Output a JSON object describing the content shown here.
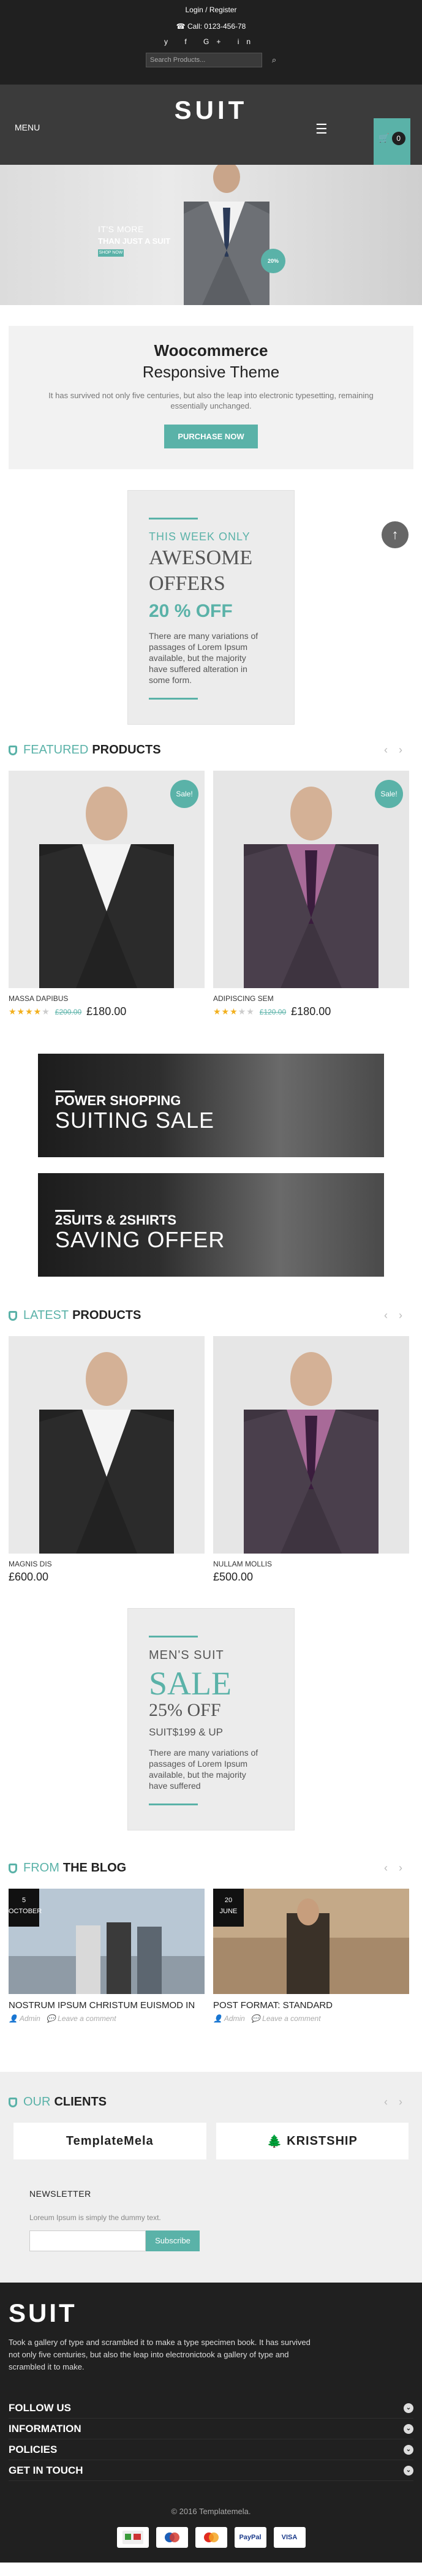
{
  "topbar": {
    "login": "Login / Register",
    "phone": "Call: 0123-456-78",
    "social": [
      "y",
      "f",
      "G+",
      "in"
    ],
    "search_placeholder": "Search Products..."
  },
  "header": {
    "menu": "MENU",
    "logo": "SUIT",
    "cart_count": "0"
  },
  "hero": {
    "line1": "IT'S MORE",
    "line2": "THAN JUST A SUIT",
    "btn": "SHOP NOW",
    "circle": "20%"
  },
  "intro": {
    "title": "Woocommerce",
    "subtitle": "Responsive Theme",
    "text": "It has survived not only five centuries, but also the leap into electronic typesetting, remaining essentially unchanged.",
    "button": "PURCHASE NOW"
  },
  "offer1": {
    "small": "THIS WEEK ONLY",
    "big1": "AWESOME",
    "big2": "OFFERS",
    "pct": "20 % OFF",
    "text": "There are many variations of passages of Lorem Ipsum available, but the majority have suffered alteration in some form."
  },
  "featured": {
    "t1": "FEATURED",
    "t2": "PRODUCTS",
    "products": [
      {
        "name": "MASSA DAPIBUS",
        "old": "£200.00",
        "price": "£180.00",
        "sale": "Sale!",
        "rating": 4
      },
      {
        "name": "ADIPISCING SEM",
        "old": "£120.00",
        "price": "£180.00",
        "sale": "Sale!",
        "rating": 3
      }
    ]
  },
  "banner1": {
    "line1": "POWER SHOPPING",
    "line2": "SUITING SALE"
  },
  "banner2": {
    "line1": "2SUITS & 2SHIRTS",
    "line2": "SAVING OFFER"
  },
  "latest": {
    "t1": "LATEST",
    "t2": "PRODUCTS",
    "products": [
      {
        "name": "MAGNIS DIS",
        "price": "£600.00"
      },
      {
        "name": "NULLAM MOLLIS",
        "price": "£500.00"
      }
    ]
  },
  "offer2": {
    "small": "MEN'S SUIT",
    "big": "SALE",
    "pct": "25% OFF",
    "price": "SUIT$199 & UP",
    "text": "There are many variations of passages of Lorem Ipsum available, but the majority have suffered"
  },
  "blog": {
    "t1": "FROM",
    "t2": "THE BLOG",
    "posts": [
      {
        "day": "5",
        "month": "OCTOBER",
        "title": "NOSTRUM IPSUM CHRISTUM EUISMOD IN",
        "author": "Admin",
        "comment": "Leave a comment"
      },
      {
        "day": "20",
        "month": "JUNE",
        "title": "POST FORMAT: STANDARD",
        "author": "Admin",
        "comment": "Leave a comment"
      }
    ]
  },
  "clients": {
    "t1": "OUR",
    "t2": "CLIENTS",
    "logos": [
      "TemplateMela",
      "KRISTSHIP"
    ]
  },
  "newsletter": {
    "title": "NEWSLETTER",
    "text": "Loreum Ipsum is simply the dummy text.",
    "button": "Subscribe"
  },
  "footer": {
    "logo": "SUIT",
    "desc": "Took a gallery of type and scrambled it to make a type specimen book. It has survived not only five centuries, but also the leap into electronictook a gallery of type and scrambled it to make.",
    "links": [
      "FOLLOW US",
      "INFORMATION",
      "POLICIES",
      "GET IN TOUCH"
    ],
    "copy": "© 2016 Templatemela.",
    "payments": [
      "",
      "",
      "",
      "PayPal",
      "VISA"
    ]
  },
  "colors": {
    "accent": "#5ab2a8",
    "dark": "#202020"
  }
}
